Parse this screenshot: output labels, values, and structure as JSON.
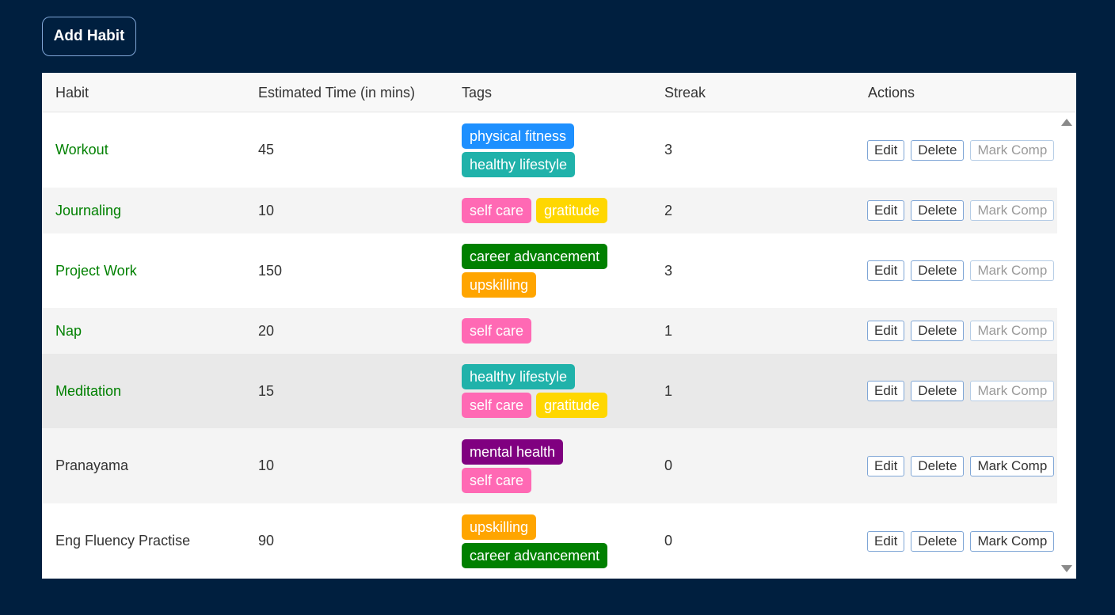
{
  "toolbar": {
    "add_label": "Add Habit"
  },
  "table": {
    "headers": [
      "Habit",
      "Estimated Time (in mins)",
      "Tags",
      "Streak",
      "Actions"
    ],
    "rows": [
      {
        "habit": "Workout",
        "time": "45",
        "streak": "3",
        "completed": true,
        "tags": [
          [
            {
              "label": "physical fitness",
              "color": "#1e90ff"
            }
          ],
          [
            {
              "label": "healthy lifestyle",
              "color": "#20b2aa"
            }
          ]
        ],
        "actions": [
          "Edit",
          "Delete",
          "Mark Comp"
        ]
      },
      {
        "habit": "Journaling",
        "time": "10",
        "streak": "2",
        "completed": true,
        "tags": [
          [
            {
              "label": "self care",
              "color": "#ff69b4"
            },
            {
              "label": "gratitude",
              "color": "#ffd700"
            }
          ]
        ],
        "actions": [
          "Edit",
          "Delete",
          "Mark Comp"
        ]
      },
      {
        "habit": "Project Work",
        "time": "150",
        "streak": "3",
        "completed": true,
        "tags": [
          [
            {
              "label": "career advancement",
              "color": "#008000"
            }
          ],
          [
            {
              "label": "upskilling",
              "color": "#ffa500"
            }
          ]
        ],
        "actions": [
          "Edit",
          "Delete",
          "Mark Comp"
        ]
      },
      {
        "habit": "Nap",
        "time": "20",
        "streak": "1",
        "completed": true,
        "tags": [
          [
            {
              "label": "self care",
              "color": "#ff69b4"
            }
          ]
        ],
        "actions": [
          "Edit",
          "Delete",
          "Mark Comp"
        ]
      },
      {
        "habit": "Meditation",
        "time": "15",
        "streak": "1",
        "completed": true,
        "hover": true,
        "tags": [
          [
            {
              "label": "healthy lifestyle",
              "color": "#20b2aa"
            }
          ],
          [
            {
              "label": "self care",
              "color": "#ff69b4"
            },
            {
              "label": "gratitude",
              "color": "#ffd700"
            }
          ]
        ],
        "actions": [
          "Edit",
          "Delete",
          "Mark Comp"
        ]
      },
      {
        "habit": "Pranayama",
        "time": "10",
        "streak": "0",
        "completed": false,
        "tags": [
          [
            {
              "label": "mental health",
              "color": "#800080"
            }
          ],
          [
            {
              "label": "self care",
              "color": "#ff69b4"
            }
          ]
        ],
        "actions": [
          "Edit",
          "Delete",
          "Mark Comp"
        ]
      },
      {
        "habit": "Eng Fluency Practise",
        "time": "90",
        "streak": "0",
        "completed": false,
        "tags": [
          [
            {
              "label": "upskilling",
              "color": "#ffa500"
            }
          ],
          [
            {
              "label": "career advancement",
              "color": "#008000"
            }
          ]
        ],
        "actions": [
          "Edit",
          "Delete",
          "Mark Comp"
        ]
      }
    ]
  },
  "colors": {
    "page_bg": "#001f3f",
    "completed_text": "#008000",
    "row_alt_bg": "#f4f4f4",
    "row_hover_bg": "#e9e9e9",
    "button_border": "#7fa6d6"
  },
  "icons": {
    "scroll_up": "caret-up-icon",
    "scroll_down": "caret-down-icon"
  }
}
